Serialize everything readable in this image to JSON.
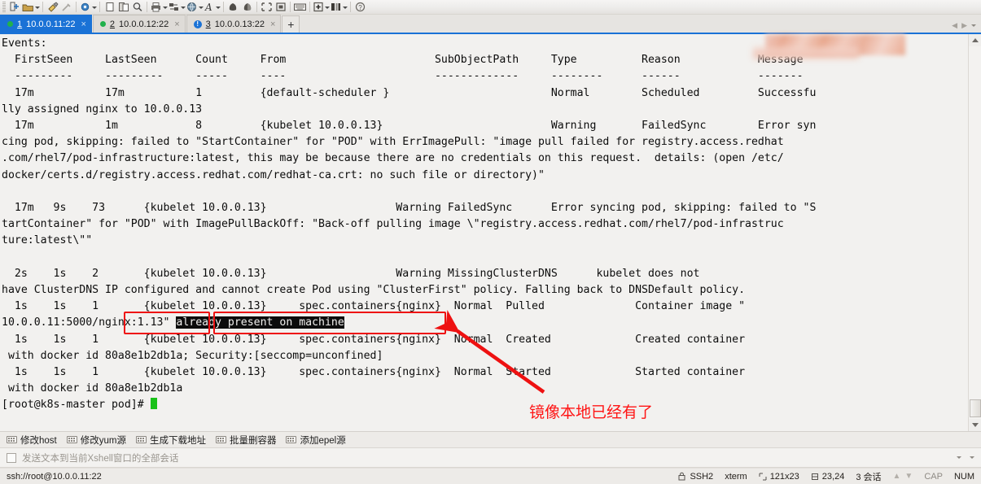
{
  "toolbar": {
    "buttons": [
      {
        "name": "new-session-icon",
        "glyph": "□+"
      },
      {
        "name": "open-folder-icon",
        "glyph": "📁",
        "dropdown": true
      },
      {
        "name": "paint-brush-icon",
        "glyph": "✎"
      },
      {
        "name": "eyedropper-icon",
        "glyph": "╱"
      },
      {
        "name": "properties-gear-icon",
        "glyph": "⚙",
        "dropdown": true
      },
      {
        "name": "copy-icon",
        "glyph": "▭"
      },
      {
        "name": "paste-icon",
        "glyph": "▤"
      },
      {
        "name": "find-icon",
        "glyph": "🔍"
      },
      {
        "name": "print-icon",
        "glyph": "⎙",
        "dropdown": true
      },
      {
        "name": "layout-icon",
        "glyph": "▦",
        "dropdown": true
      },
      {
        "name": "globe-icon",
        "glyph": "🌐",
        "dropdown": true
      },
      {
        "name": "font-icon",
        "glyph": "A",
        "dropdown": true
      },
      {
        "name": "compose-icon",
        "glyph": "◐"
      },
      {
        "name": "paint-bucket-icon",
        "glyph": "◑"
      },
      {
        "name": "fullscreen-icon",
        "glyph": "⛶"
      },
      {
        "name": "window-icon",
        "glyph": "▣"
      },
      {
        "name": "keyboard-icon",
        "glyph": "⌨"
      },
      {
        "name": "zoom-in-icon",
        "glyph": "＋",
        "dropdown": true
      },
      {
        "name": "columns-icon",
        "glyph": "▐▐",
        "dropdown": true
      },
      {
        "name": "help-icon",
        "glyph": "?"
      }
    ]
  },
  "tabs": [
    {
      "num": "1",
      "label": "10.0.0.11:22",
      "status": "connected",
      "active": true,
      "close": "×"
    },
    {
      "num": "2",
      "label": "10.0.0.12:22",
      "status": "connected",
      "active": false,
      "close": "×"
    },
    {
      "num": "3",
      "label": "10.0.0.13:22",
      "status": "alert",
      "active": false,
      "close": "×"
    }
  ],
  "tab_add_label": "+",
  "terminal": {
    "lines": [
      "Events:",
      "  FirstSeen     LastSeen      Count     From                       SubObjectPath     Type          Reason            Message",
      "  ---------     ---------     -----     ----                       -------------     --------      ------            -------",
      "  17m           17m           1         {default-scheduler }                         Normal        Scheduled         Successfu",
      "lly assigned nginx to 10.0.0.13",
      "  17m           1m            8         {kubelet 10.0.0.13}                          Warning       FailedSync        Error syn",
      "cing pod, skipping: failed to \"StartContainer\" for \"POD\" with ErrImagePull: \"image pull failed for registry.access.redhat",
      ".com/rhel7/pod-infrastructure:latest, this may be because there are no credentials on this request.  details: (open /etc/",
      "docker/certs.d/registry.access.redhat.com/redhat-ca.crt: no such file or directory)\"",
      "",
      "  17m   9s    73      {kubelet 10.0.0.13}                    Warning FailedSync      Error syncing pod, skipping: failed to \"S",
      "tartContainer\" for \"POD\" with ImagePullBackOff: \"Back-off pulling image \\\"registry.access.redhat.com/rhel7/pod-infrastruc",
      "ture:latest\\\"\"",
      "",
      "  2s    1s    2       {kubelet 10.0.0.13}                    Warning MissingClusterDNS      kubelet does not",
      "have ClusterDNS IP configured and cannot create Pod using \"ClusterFirst\" policy. Falling back to DNSDefault policy.",
      "  1s    1s    1       {kubelet 10.0.0.13}     spec.containers{nginx}  Normal  Pulled              Container image \"",
      "10.0.0.11:5000/nginx:1.13\" already present on machine",
      "  1s    1s    1       {kubelet 10.0.0.13}     spec.containers{nginx}  Normal  Created             Created container",
      " with docker id 80a8e1b2db1a; Security:[seccomp=unconfined]",
      "  1s    1s    1       {kubelet 10.0.0.13}     spec.containers{nginx}  Normal  Started             Started container",
      " with docker id 80a8e1b2db1a",
      "[root@k8s-master pod]# "
    ],
    "highlighted_text": "already present on machine",
    "prompt": "[root@k8s-master pod]# "
  },
  "annotations": {
    "chinese_note": "镜像本地已经有了",
    "box1_target": "nginx:1.13",
    "box2_target": "already present on machine",
    "accent_color": "#ee1111"
  },
  "quickbar": {
    "items": [
      {
        "label": "修改host"
      },
      {
        "label": "修改yum源"
      },
      {
        "label": "生成下载地址"
      },
      {
        "label": "批量删容器"
      },
      {
        "label": "添加epel源"
      }
    ]
  },
  "sendbar": {
    "checkbox_label": "发送文本到当前Xshell窗口的全部会话",
    "checked": false
  },
  "statusbar": {
    "connection": "ssh://root@10.0.0.11:22",
    "protocol": "SSH2",
    "terminal_type": "xterm",
    "size": "121x23",
    "cursor_pos": "23,24",
    "sessions": "3 会话",
    "cap": "CAP",
    "num": "NUM"
  }
}
